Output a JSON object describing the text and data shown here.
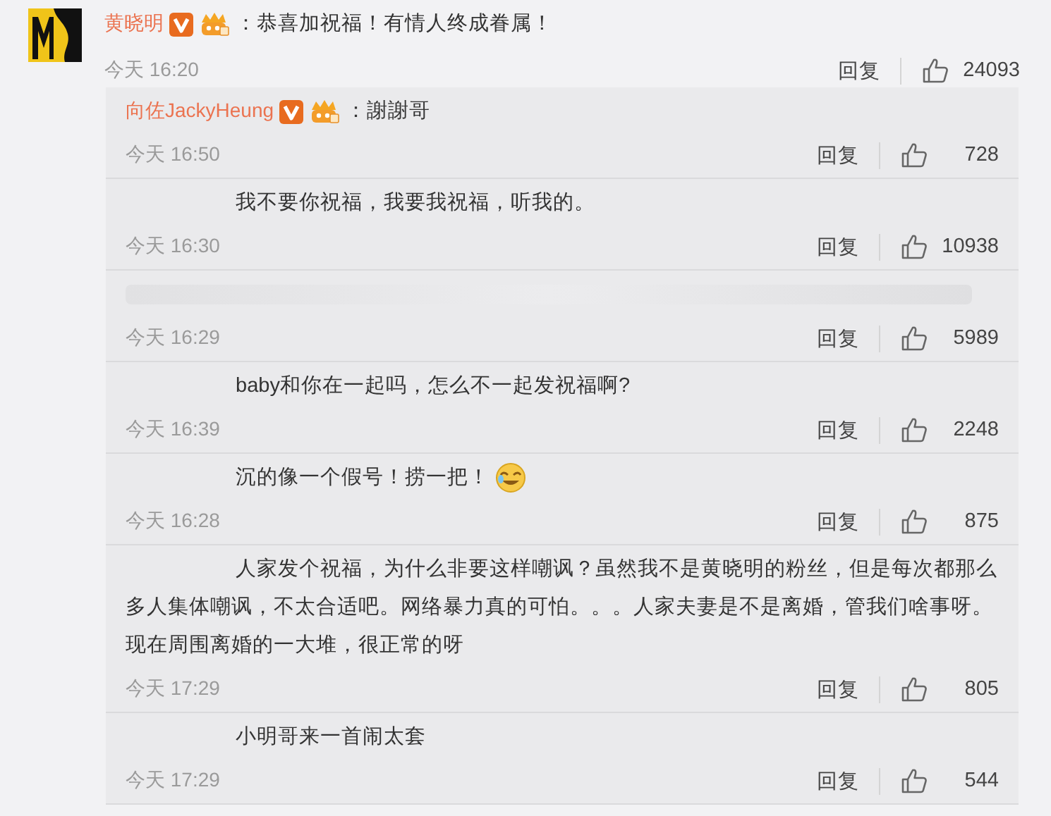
{
  "comment": {
    "author": "黄晓明",
    "verified": true,
    "fan_badge": true,
    "text": "：恭喜加祝福！有情人终成眷属！",
    "time": "今天 16:20",
    "reply_label": "回复",
    "likes": "24093"
  },
  "replies": [
    {
      "kind": "named",
      "author": "向佐JackyHeung",
      "verified": true,
      "fan_badge": true,
      "text": "：謝謝哥",
      "time": "今天 16:50",
      "reply_label": "回复",
      "likes": "728"
    },
    {
      "kind": "masked",
      "text": "我不要你祝福，我要我祝福，听我的。",
      "time": "今天 16:30",
      "reply_label": "回复",
      "likes": "10938"
    },
    {
      "kind": "hidden",
      "time": "今天 16:29",
      "reply_label": "回复",
      "likes": "5989"
    },
    {
      "kind": "masked",
      "text": "baby和你在一起吗，怎么不一起发祝福啊?",
      "time": "今天 16:39",
      "reply_label": "回复",
      "likes": "2248"
    },
    {
      "kind": "masked",
      "text": "沉的像一个假号！捞一把！",
      "emoji": true,
      "time": "今天 16:28",
      "reply_label": "回复",
      "likes": "875"
    },
    {
      "kind": "masked",
      "text": "人家发个祝福，为什么非要这样嘲讽？虽然我不是黄晓明的粉丝，但是每次都那么多人集体嘲讽，不太合适吧。网络暴力真的可怕。。。人家夫妻是不是离婚，管我们啥事呀。现在周围离婚的一大堆，很正常的呀",
      "time": "今天 17:29",
      "reply_label": "回复",
      "likes": "805"
    },
    {
      "kind": "masked",
      "text": "小明哥来一首闹太套",
      "time": "今天 17:29",
      "reply_label": "回复",
      "likes": "544"
    }
  ]
}
